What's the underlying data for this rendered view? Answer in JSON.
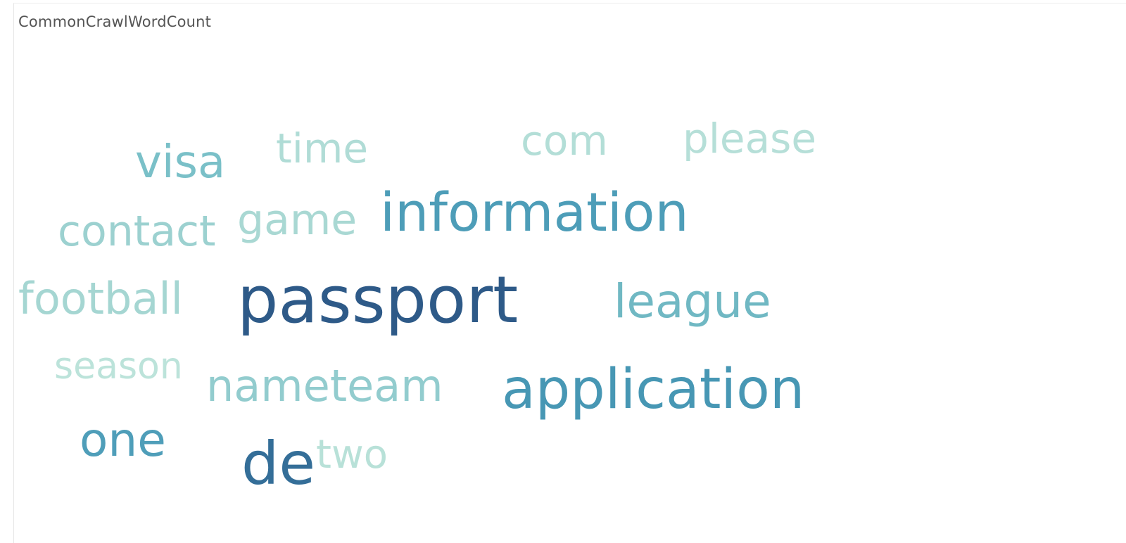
{
  "sheet": {
    "title": "CommonCrawlWordCount"
  },
  "chart_data": {
    "type": "word_cloud",
    "title": "CommonCrawlWordCount",
    "color_scale": [
      "#b9e3d9",
      "#2c5985"
    ],
    "words": [
      {
        "text": "passport",
        "size": 100,
        "color": "#2e5a88"
      },
      {
        "text": "de",
        "size": 92,
        "color": "#346e98"
      },
      {
        "text": "application",
        "size": 78,
        "color": "#4797b4"
      },
      {
        "text": "information",
        "size": 76,
        "color": "#4d9db8"
      },
      {
        "text": "one",
        "size": 70,
        "color": "#4f9eb9"
      },
      {
        "text": "league",
        "size": 62,
        "color": "#70b8c3"
      },
      {
        "text": "visa",
        "size": 60,
        "color": "#7ac0c8"
      },
      {
        "text": "nameteam",
        "size": 56,
        "color": "#92ccce"
      },
      {
        "text": "contact",
        "size": 54,
        "color": "#9cd1d0"
      },
      {
        "text": "football",
        "size": 52,
        "color": "#a5d6d2"
      },
      {
        "text": "game",
        "size": 50,
        "color": "#a9d8d3"
      },
      {
        "text": "time",
        "size": 48,
        "color": "#b0dcd6"
      },
      {
        "text": "com",
        "size": 46,
        "color": "#b3ded7"
      },
      {
        "text": "please",
        "size": 45,
        "color": "#b6dfd8"
      },
      {
        "text": "two",
        "size": 44,
        "color": "#b8e1d8"
      },
      {
        "text": "season",
        "size": 42,
        "color": "#bce3da"
      }
    ]
  }
}
